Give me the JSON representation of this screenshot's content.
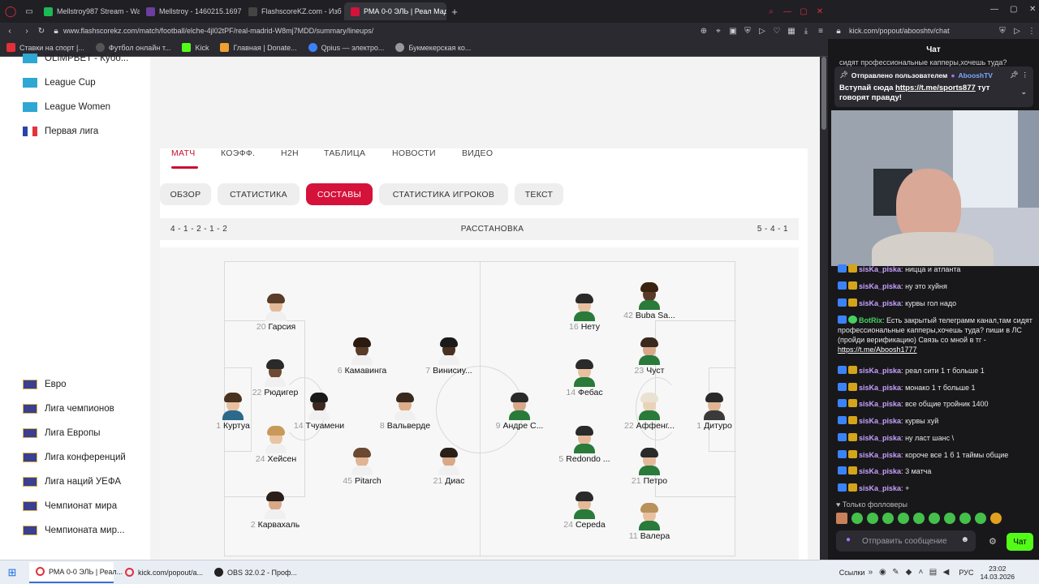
{
  "tabs": [
    {
      "label": "Mellstroy987 Stream - Wa",
      "color": "#1db954"
    },
    {
      "label": "Mellstroy - 1460215.1697",
      "color": "#6a3fa0"
    },
    {
      "label": "FlashscoreKZ.com - Изб",
      "color": "#333333"
    },
    {
      "label": "РМА 0-0 ЭЛЬ | Реал Мад",
      "color": "#d5123a"
    }
  ],
  "url": "www.flashscorekz.com/match/football/elche-4jl02tPF/real-madrid-W8mj7MDD/summary/lineups/",
  "right_url": "kick.com/popout/abooshtv/chat",
  "bookmarks": [
    "Ставки на спорт |...",
    "Футбол онлайн т...",
    "Kick",
    "Главная | Donate...",
    "Qpius — электро...",
    "Букмекерская ко..."
  ],
  "sidebar": {
    "top_items": [
      {
        "label": "OLIMPBET - Кубо...",
        "flag": "kz"
      },
      {
        "label": "League Cup",
        "flag": "kz"
      },
      {
        "label": "League Women",
        "flag": "kz"
      },
      {
        "label": "Первая лига",
        "flag": "fr"
      }
    ],
    "bottom_items": [
      {
        "label": "Евро"
      },
      {
        "label": "Лига чемпионов"
      },
      {
        "label": "Лига Европы"
      },
      {
        "label": "Лига конференций"
      },
      {
        "label": "Лига наций УЕФА"
      },
      {
        "label": "Чемпионат мира"
      },
      {
        "label": "Чемпионата мир..."
      }
    ]
  },
  "match_nav": [
    "МАТЧ",
    "КОЭФФ.",
    "H2H",
    "ТАБЛИЦА",
    "НОВОСТИ",
    "ВИДЕО"
  ],
  "sub_tabs": [
    "ОБЗОР",
    "СТАТИСТИКА",
    "СОСТАВЫ",
    "СТАТИСТИКА ИГРОКОВ",
    "ТЕКСТ"
  ],
  "formation": {
    "home": "4 - 1 - 2 - 1 - 2",
    "title": "РАССТАНОВКА",
    "away": "5 - 4 - 1"
  },
  "home_players": [
    {
      "num": "20",
      "name": "Гарсия"
    },
    {
      "num": "22",
      "name": "Рюдигер"
    },
    {
      "num": "1",
      "name": "Куртуа"
    },
    {
      "num": "24",
      "name": "Хейсен"
    },
    {
      "num": "2",
      "name": "Карвахаль"
    },
    {
      "num": "14",
      "name": "Тчуамени"
    },
    {
      "num": "6",
      "name": "Камавинга"
    },
    {
      "num": "7",
      "name": "Винисиу..."
    },
    {
      "num": "8",
      "name": "Вальверде"
    },
    {
      "num": "45",
      "name": "Pitarch"
    },
    {
      "num": "21",
      "name": "Диас"
    }
  ],
  "away_players": [
    {
      "num": "9",
      "name": "Андре С..."
    },
    {
      "num": "16",
      "name": "Нету"
    },
    {
      "num": "14",
      "name": "Фебас"
    },
    {
      "num": "5",
      "name": "Redondo ..."
    },
    {
      "num": "24",
      "name": "Cepeda"
    },
    {
      "num": "42",
      "name": "Buba Sa..."
    },
    {
      "num": "23",
      "name": "Чуст"
    },
    {
      "num": "22",
      "name": "Аффенг..."
    },
    {
      "num": "21",
      "name": "Петро"
    },
    {
      "num": "11",
      "name": "Валера"
    },
    {
      "num": "1",
      "name": "Дитуро"
    }
  ],
  "chat": {
    "title": "Чат",
    "overflow_text": "сидят профессиональные капперы,хочешь туда?",
    "pinned_by": "Отправлено пользователем",
    "pinned_user": "AbooshTV",
    "pinned_text": "Вступай сюда",
    "pinned_link": "https://t.me/sports877",
    "pinned_text2": "тут говорят правду!",
    "messages": [
      {
        "user": "sisKa_piska",
        "text": "ницца и атланта"
      },
      {
        "user": "sisKa_piska",
        "text": "ну это хуйня"
      },
      {
        "user": "sisKa_piska",
        "text": "курвы гол надо"
      },
      {
        "user": "BotRix",
        "text": "Есть закрытый телеграмм канал,там сидят профессиональные капперы,хочешь туда? пиши в ЛС (пройди верификацию) Связь со мной в тг -",
        "link": "https://t.me/Aboosh1777"
      },
      {
        "user": "sisKa_piska",
        "text": "реал сити 1 т больше 1"
      },
      {
        "user": "sisKa_piska",
        "text": "монако 1 т больше 1"
      },
      {
        "user": "sisKa_piska",
        "text": "все общие тройник 1400"
      },
      {
        "user": "sisKa_piska",
        "text": "курвы хуй"
      },
      {
        "user": "sisKa_piska",
        "text": "ну ласт шанс \\"
      },
      {
        "user": "sisKa_piska",
        "text": "короче все 1 б 1 таймы общие"
      },
      {
        "user": "sisKa_piska",
        "text": "3 матча"
      },
      {
        "user": "sisKa_piska",
        "text": "+"
      }
    ],
    "followers_only": "Только фолловеры",
    "input_placeholder": "Отправить сообщение",
    "send_label": "Чат"
  },
  "taskbar": {
    "items": [
      "РМА 0-0 ЭЛЬ | Реал...",
      "kick.com/popout/a...",
      "OBS 32.0.2 - Проф..."
    ],
    "links_label": "Ссылки",
    "lang": "РУС",
    "time": "23:02",
    "date": "14.03.2026"
  },
  "colors": {
    "accent": "#d5123a",
    "kick_green": "#53fc18"
  }
}
